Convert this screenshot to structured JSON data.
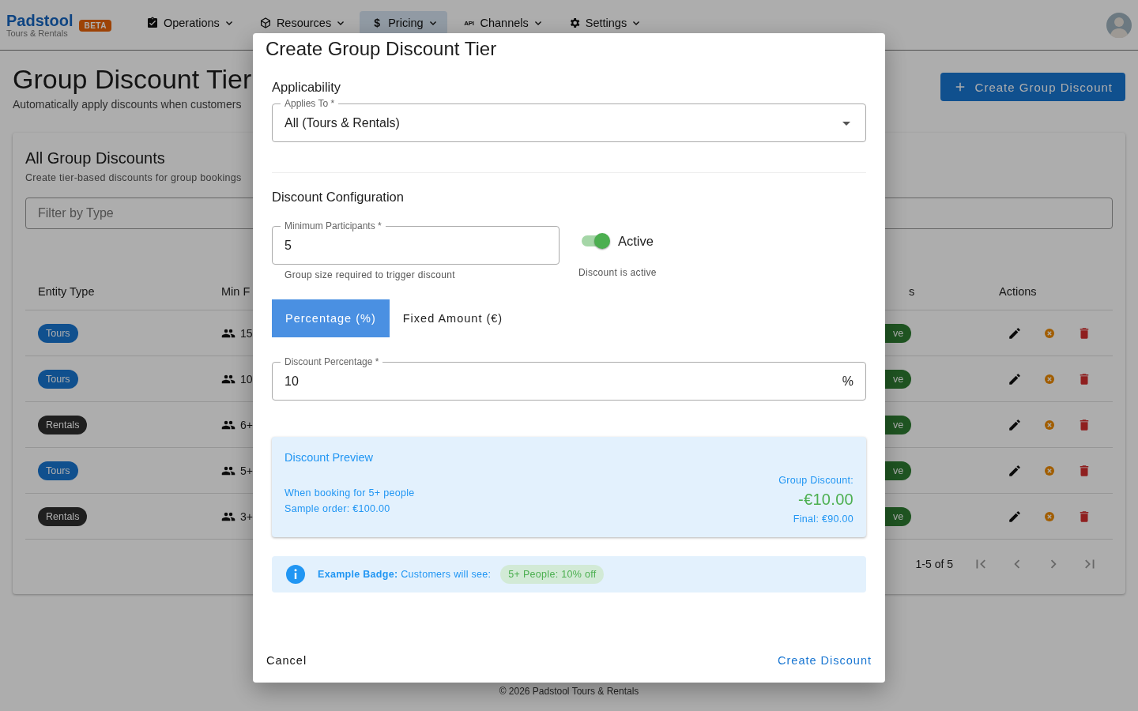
{
  "header": {
    "logo": "Padstool",
    "logo_sub": "Tours & Rentals",
    "badge": "BETA",
    "nav": [
      {
        "label": "Operations",
        "selected": false
      },
      {
        "label": "Resources",
        "selected": false
      },
      {
        "label": "Pricing",
        "glyph": "$",
        "selected": true
      },
      {
        "label": "Channels",
        "glyph": "API",
        "selected": false
      },
      {
        "label": "Settings",
        "selected": false
      }
    ]
  },
  "page": {
    "title": "Group Discount Tier",
    "subtitle": "Automatically apply discounts when customers",
    "create_button": "Create Group Discount"
  },
  "card": {
    "title": "All Group Discounts",
    "subtitle": "Create tier-based discounts for group bookings",
    "filter": {
      "placeholder": "Filter by Type"
    },
    "columns": [
      "Entity Type",
      "Min F",
      "s",
      "Actions"
    ],
    "rows": [
      {
        "entity": "Tours",
        "kind": "tour",
        "min": "15",
        "status": "ve"
      },
      {
        "entity": "Tours",
        "kind": "tour",
        "min": "10",
        "status": "ve"
      },
      {
        "entity": "Rentals",
        "kind": "rental",
        "min": "6+",
        "status": "ve"
      },
      {
        "entity": "Tours",
        "kind": "tour",
        "min": "5+",
        "status": "ve"
      },
      {
        "entity": "Rentals",
        "kind": "rental",
        "min": "3+",
        "status": "ve"
      }
    ],
    "pagination": "1-5 of 5"
  },
  "modal": {
    "title": "Create Group Discount Tier",
    "applicability": {
      "heading": "Applicability",
      "select": {
        "label": "Applies To *",
        "value": "All (Tours & Rentals)"
      }
    },
    "configuration": {
      "heading": "Discount Configuration",
      "min_field": {
        "label": "Minimum Participants *",
        "value": "5",
        "helper": "Group size required to trigger discount"
      },
      "toggle": {
        "label": "Active",
        "on": true,
        "helper": "Discount is active"
      },
      "types": [
        {
          "label": "Percentage (%)",
          "selected": true
        },
        {
          "label": "Fixed Amount (€)",
          "selected": false
        }
      ],
      "value_field": {
        "label": "Discount Percentage *",
        "value": "10",
        "suffix": "%"
      }
    },
    "preview": {
      "title": "Discount Preview",
      "lines": [
        "When booking for 5+ people",
        "Sample order: €100.00"
      ],
      "discount_label": "Group Discount:",
      "discount": "-€10.00",
      "final": "Final: €90.00"
    },
    "example": {
      "text": "**Example Badge:** Customers will see:",
      "badge": "5+ People: 10% off"
    },
    "cancel": "Cancel",
    "submit": "Create Discount"
  },
  "footer": "© 2026 Padstool Tours & Rentals"
}
